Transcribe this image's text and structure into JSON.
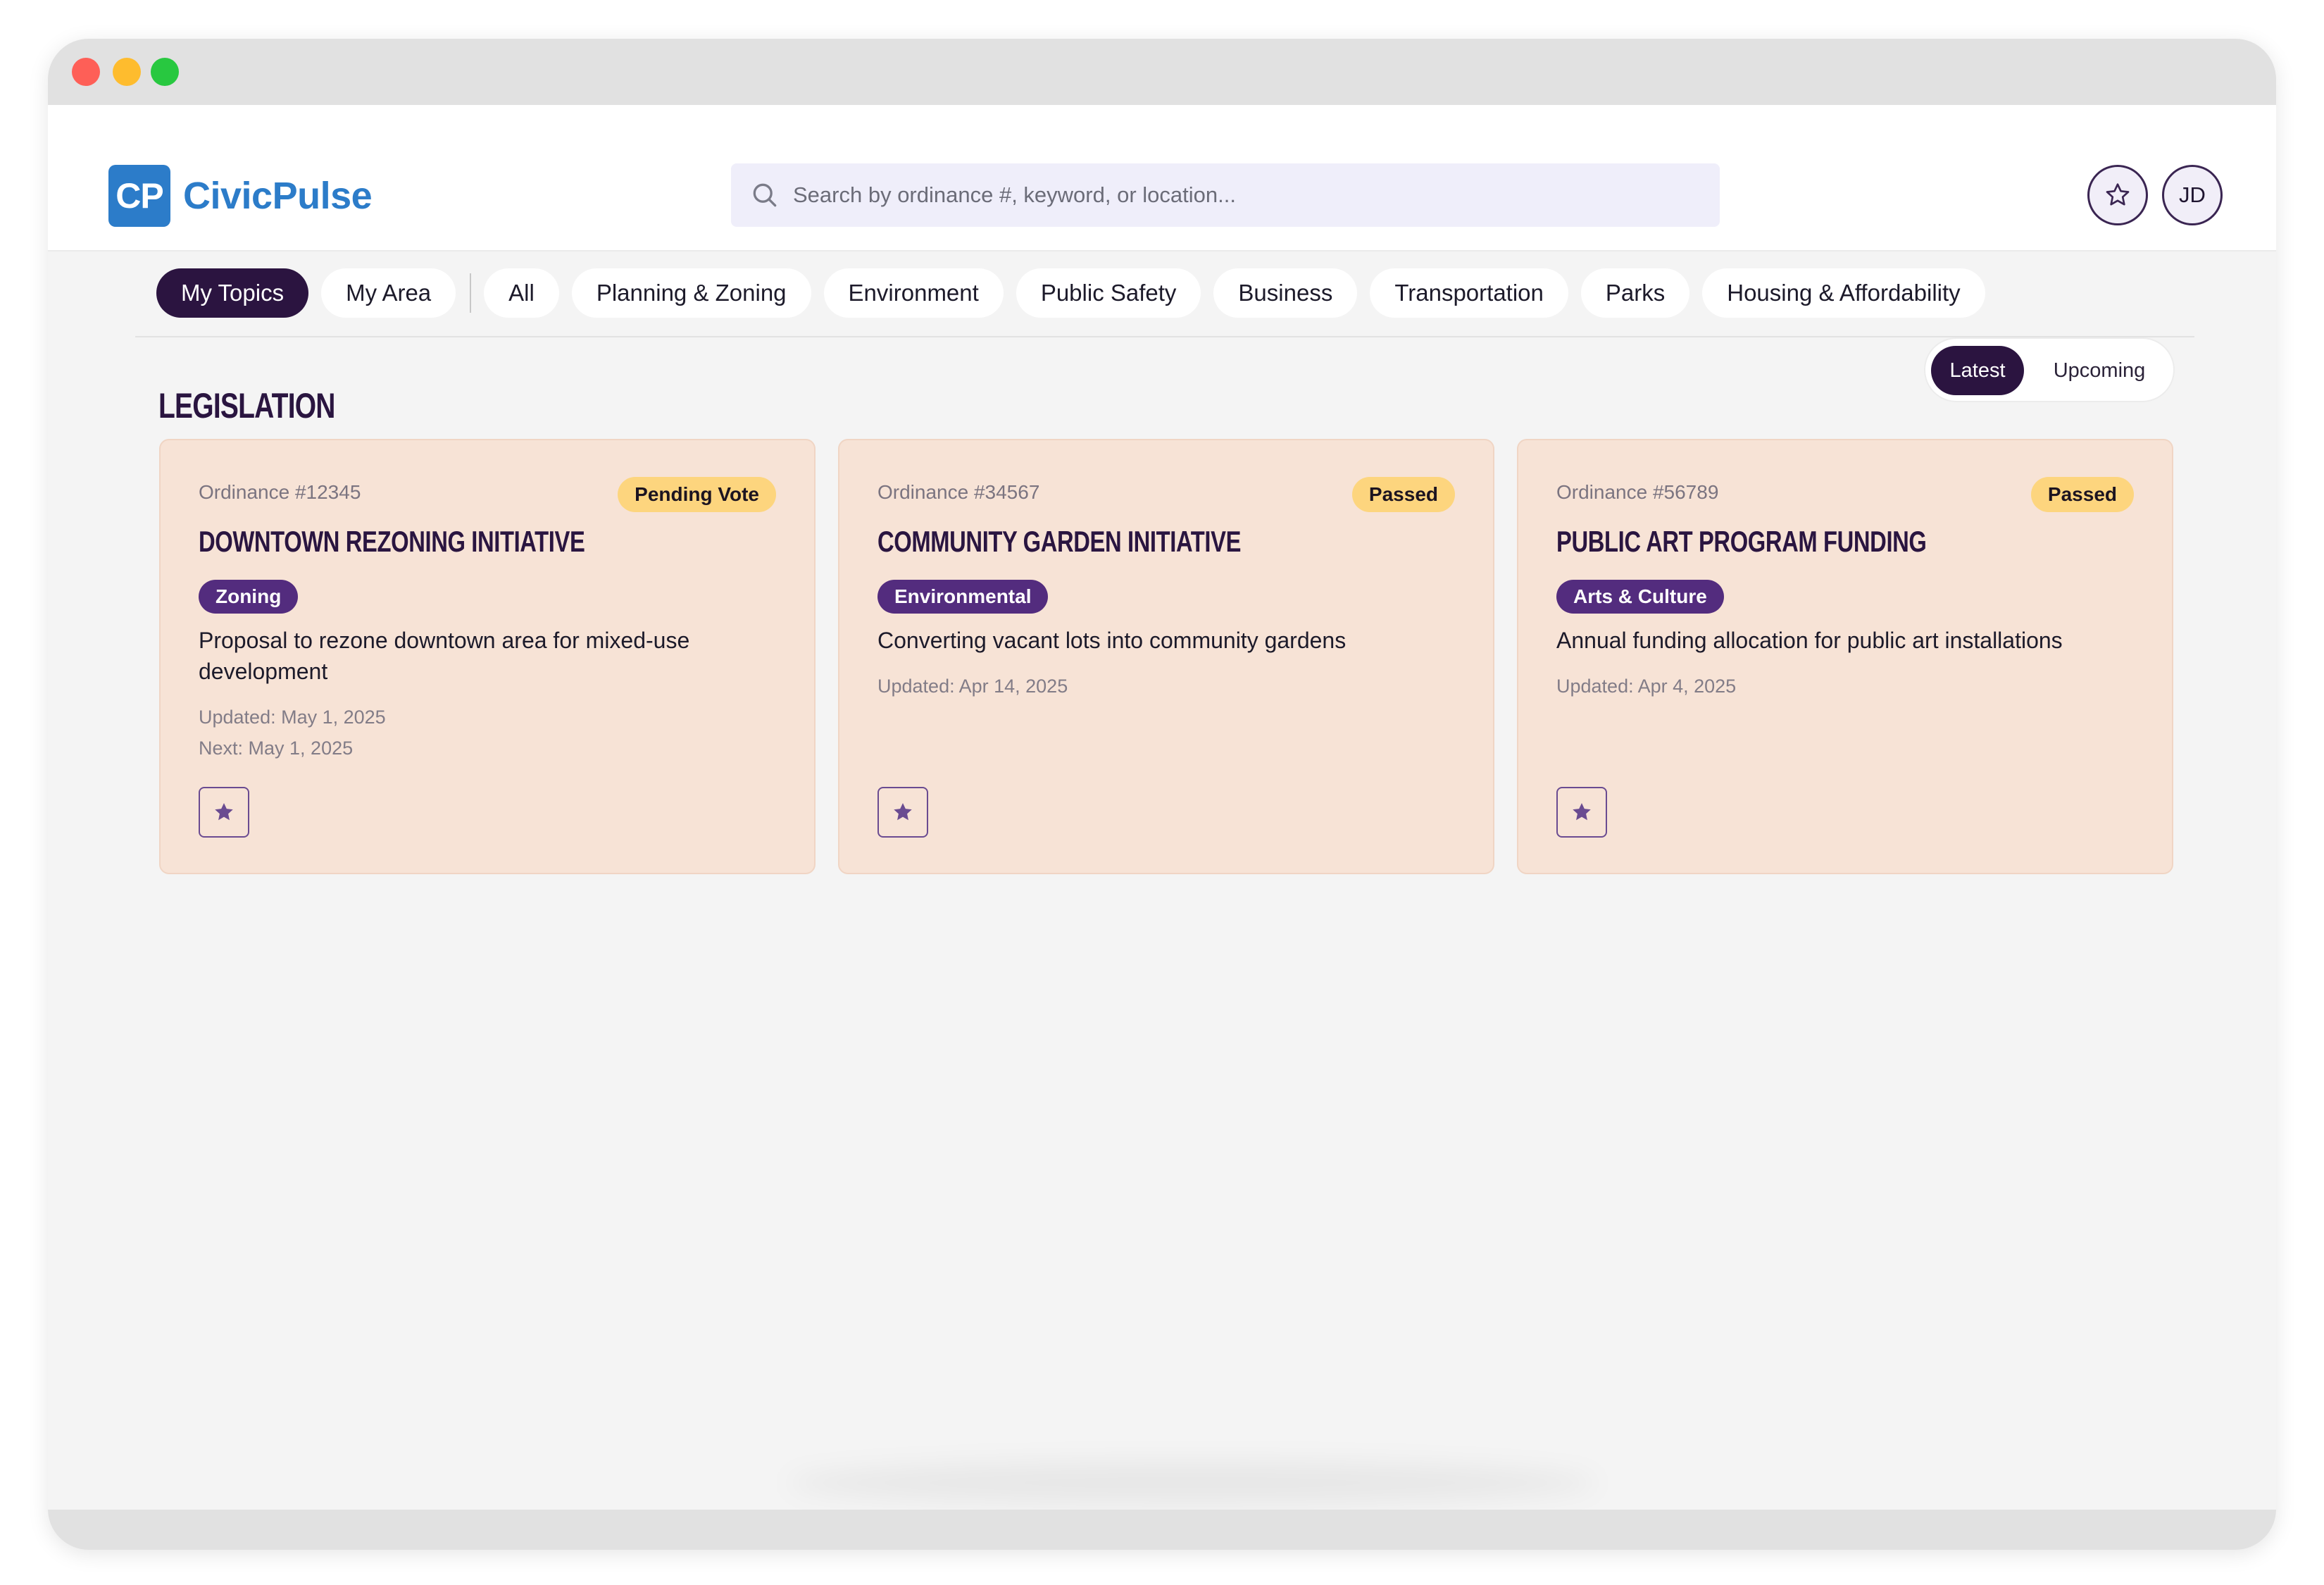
{
  "app": {
    "logo_mark": "CP",
    "name": "CivicPulse"
  },
  "search": {
    "placeholder": "Search by ordinance #, keyword, or location..."
  },
  "header": {
    "favorites_icon": "star-outline-icon",
    "avatar_initials": "JD"
  },
  "filters": {
    "primary": [
      "My Topics",
      "My Area"
    ],
    "categories": [
      "All",
      "Planning & Zoning",
      "Environment",
      "Public Safety",
      "Business",
      "Transportation",
      "Parks",
      "Housing & Affordability"
    ],
    "active": "My Topics"
  },
  "section": {
    "title": "LEGISLATION",
    "toggle": {
      "options": [
        "Latest",
        "Upcoming"
      ],
      "selected": "Latest"
    }
  },
  "cards": [
    {
      "ordinance": "Ordinance #12345",
      "status": "Pending Vote",
      "title": "DOWNTOWN REZONING INITIATIVE",
      "category": "Zoning",
      "description": "Proposal to rezone downtown area for mixed-use development",
      "updated": "Updated: May 1, 2025",
      "next": "Next: May 1, 2025"
    },
    {
      "ordinance": "Ordinance #34567",
      "status": "Passed",
      "title": "COMMUNITY GARDEN INITIATIVE",
      "category": "Environmental",
      "description": "Converting vacant lots into community gardens",
      "updated": "Updated: Apr 14, 2025"
    },
    {
      "ordinance": "Ordinance #56789",
      "status": "Passed",
      "title": "PUBLIC ART PROGRAM FUNDING",
      "category": "Arts & Culture",
      "description": "Annual funding allocation for public art installations",
      "updated": "Updated: Apr 4, 2025"
    }
  ],
  "colors": {
    "brand": "#2c7cc9",
    "primary_dark": "#2b1440",
    "card_bg": "#f7e3d6",
    "status_badge": "#fdd57e",
    "category_badge": "#532c7e"
  }
}
